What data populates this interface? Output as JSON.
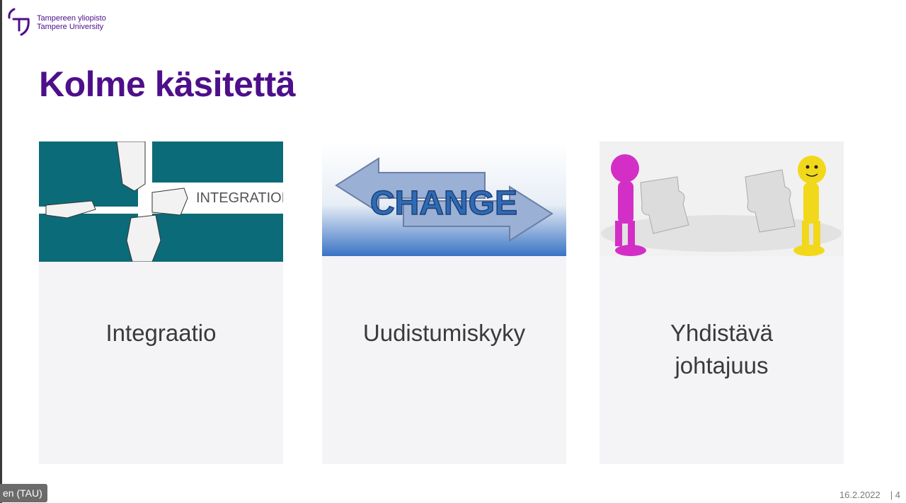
{
  "logo": {
    "line1": "Tampereen yliopisto",
    "line2": "Tampere University"
  },
  "slide": {
    "title": "Kolme käsitettä",
    "cards": [
      {
        "image_text": "INTEGRATION",
        "label": "Integraatio"
      },
      {
        "image_text": "CHANGE",
        "label": "Uudistumiskyky"
      },
      {
        "image_text": "",
        "label_line1": "Yhdistävä",
        "label_line2": "johtajuus"
      }
    ],
    "date": "16.2.2022",
    "page": "| 4"
  },
  "presenter": {
    "name": "en (TAU)"
  },
  "colors": {
    "brand_purple": "#4e0f8a",
    "teal": "#0c6b78",
    "card_bg": "#f4f4f6",
    "change_blue": "#2e6bb5",
    "magenta_figure": "#d32fc7",
    "yellow_figure": "#f2d81a"
  },
  "icons": {
    "logo": "tampere-university-logo-icon"
  }
}
